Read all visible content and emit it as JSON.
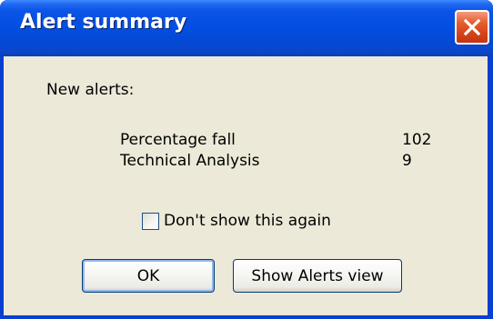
{
  "window": {
    "title": "Alert summary"
  },
  "content": {
    "heading": "New alerts:",
    "alerts": [
      {
        "label": "Percentage fall",
        "count": "102"
      },
      {
        "label": "Technical Analysis",
        "count": "9"
      }
    ],
    "checkbox": {
      "label": "Don't show this again",
      "checked": false
    }
  },
  "buttons": {
    "ok_label": "OK",
    "show_alerts_label": "Show Alerts view"
  },
  "icons": {
    "close": "close-icon"
  },
  "colors": {
    "titlebar": "#0350e0",
    "close_button": "#d6431a",
    "dialog_face": "#ece9d8",
    "button_border": "#003c74"
  }
}
